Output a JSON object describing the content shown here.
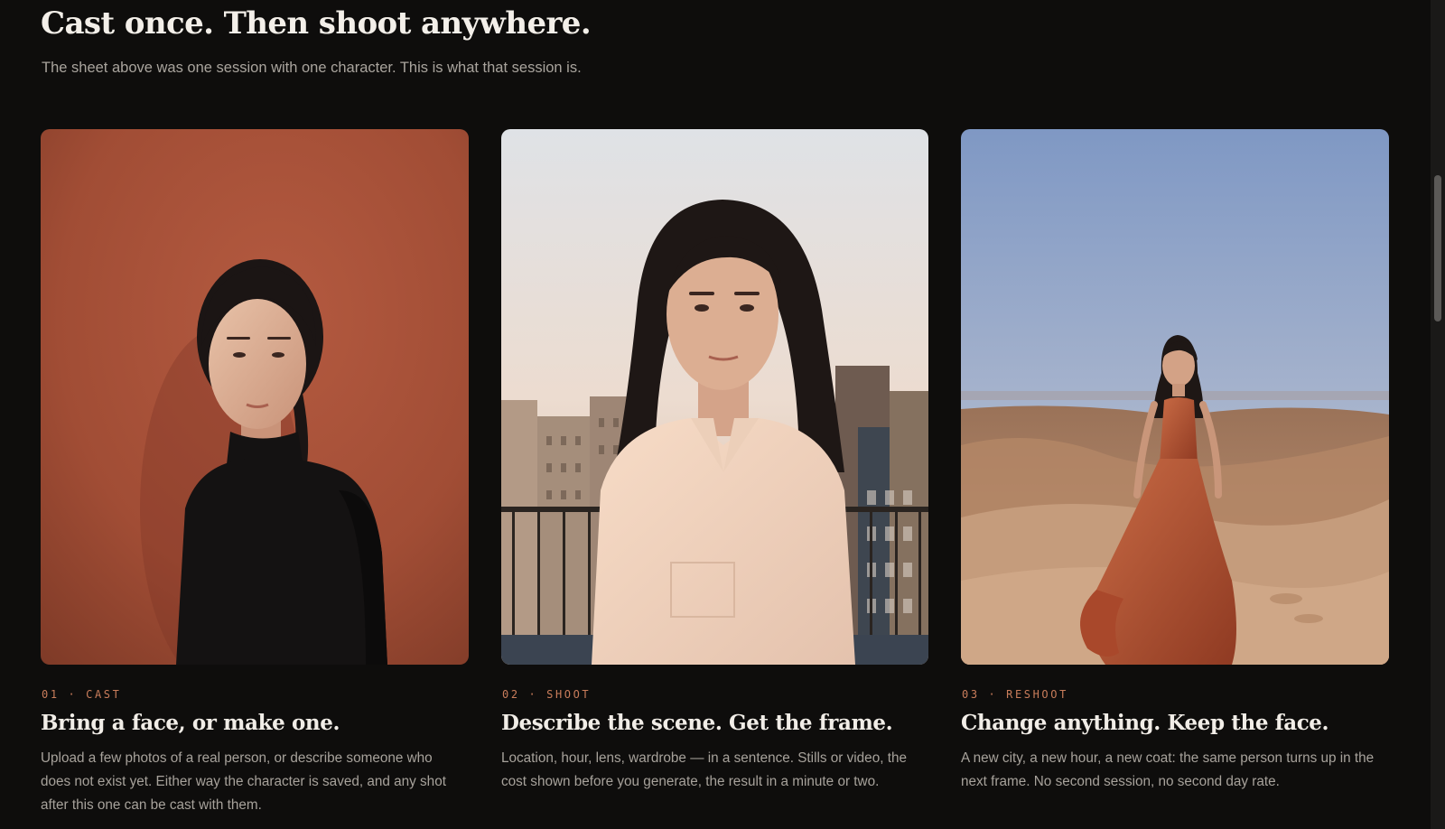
{
  "section": {
    "title": "Cast once. Then shoot anywhere.",
    "subtitle": "The sheet above was one session with one character. This is what that session is."
  },
  "colors": {
    "background": "#0e0d0c",
    "accent": "#c97d5b",
    "heading": "#f3efe9",
    "body_text": "#a7a29b"
  },
  "cards": [
    {
      "eyebrow": "01 · CAST",
      "title": "Bring a face, or make one.",
      "body": "Upload a few photos of a real person, or describe someone who does not exist yet. Either way the character is saved, and any shot after this one can be cast with them.",
      "photo": "portrait-terracotta-backdrop"
    },
    {
      "eyebrow": "02 · SHOOT",
      "title": "Describe the scene. Get the frame.",
      "body": "Location, hour, lens, wardrobe — in a sentence. Stills or video, the cost shown before you generate, the result in a minute or two.",
      "photo": "portrait-rooftop-city"
    },
    {
      "eyebrow": "03 · RESHOOT",
      "title": "Change anything. Keep the face.",
      "body": "A new city, a new hour, a new coat: the same person turns up in the next frame. No second session, no second day rate.",
      "photo": "portrait-desert-dunes"
    }
  ]
}
